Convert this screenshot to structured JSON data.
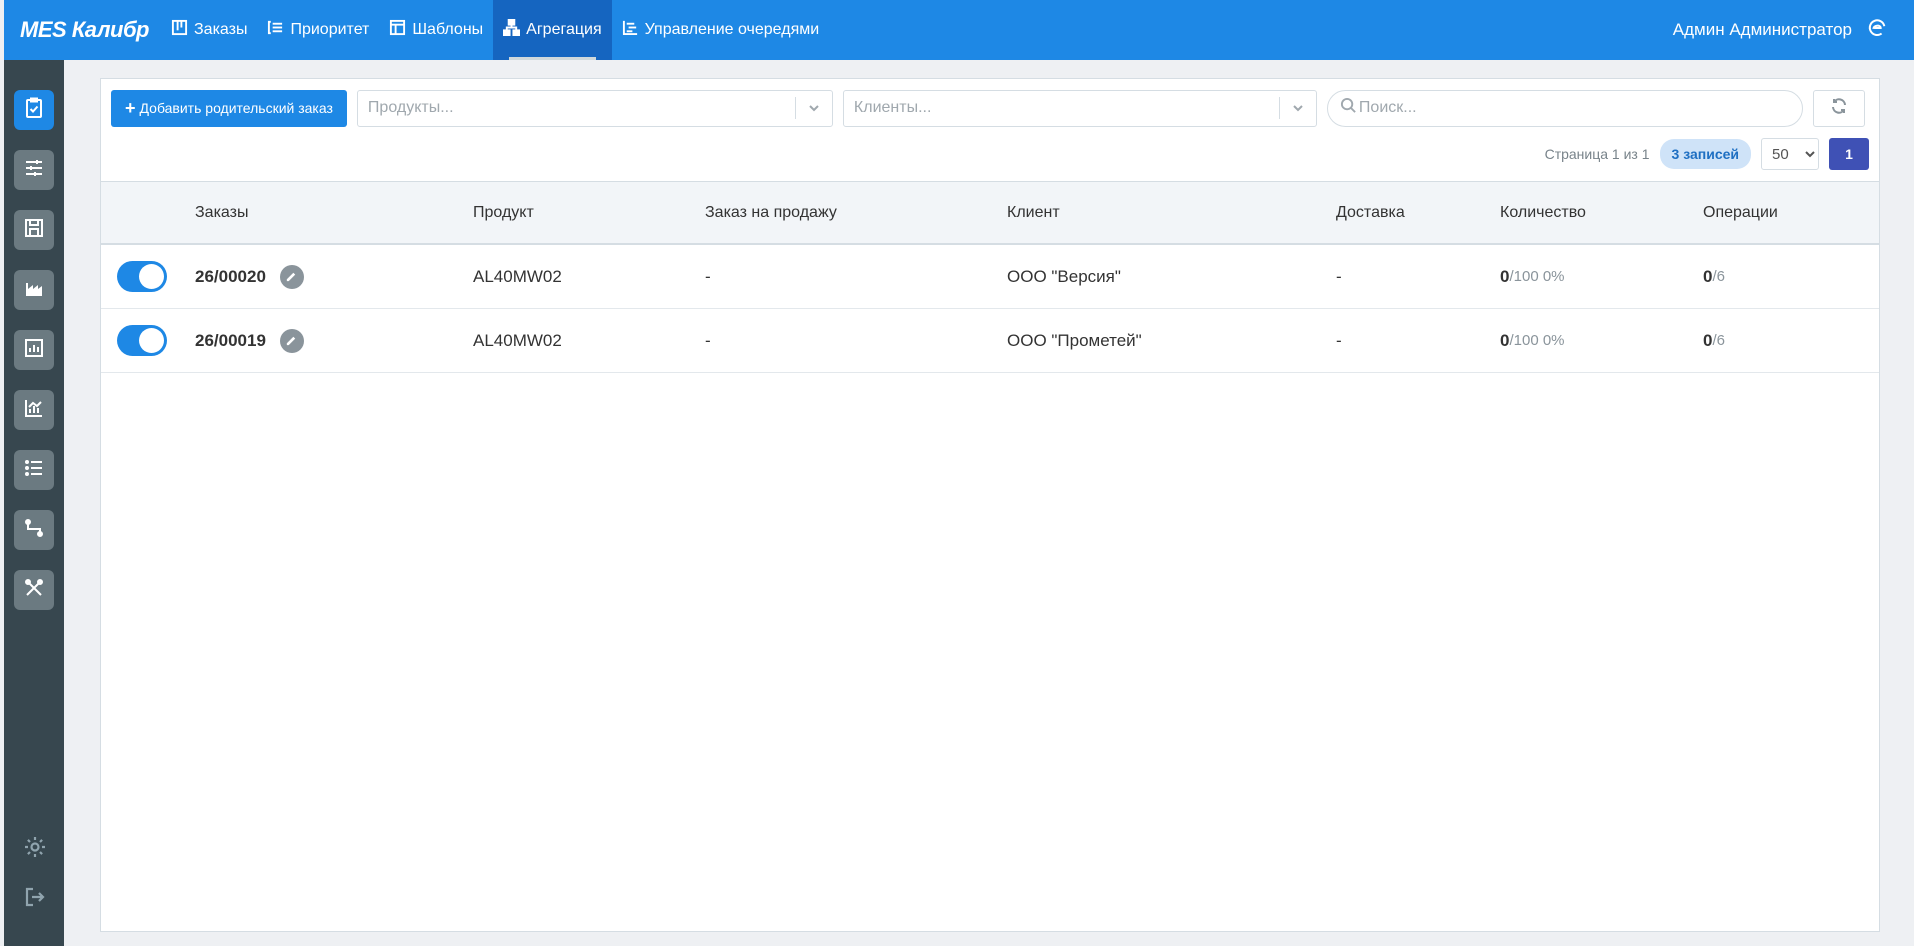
{
  "app": {
    "brand": "MES Калибр"
  },
  "nav": [
    {
      "label": "Заказы",
      "icon": "board-icon",
      "active": false
    },
    {
      "label": "Приоритет",
      "icon": "priority-icon",
      "active": false
    },
    {
      "label": "Шаблоны",
      "icon": "template-icon",
      "active": false
    },
    {
      "label": "Агрегация",
      "icon": "aggregation-icon",
      "active": true
    },
    {
      "label": "Управление очередями",
      "icon": "queue-icon",
      "active": false
    }
  ],
  "user": {
    "name": "Админ Администратор"
  },
  "sidebar": {
    "items": [
      "orders-icon",
      "sliders-icon",
      "save-icon",
      "factory-icon",
      "bar-chart-icon",
      "line-chart-icon",
      "list-icon",
      "route-icon",
      "tools-icon"
    ],
    "bottom": [
      "settings-icon",
      "logout-icon"
    ]
  },
  "toolbar": {
    "add_label": "Добавить родительский заказ",
    "products_placeholder": "Продукты...",
    "clients_placeholder": "Клиенты...",
    "search_placeholder": "Поиск..."
  },
  "pager": {
    "page_text": "Страница 1 из 1",
    "records_badge": "3 записей",
    "page_size": "50",
    "current_page": "1"
  },
  "table": {
    "columns": [
      "Заказы",
      "Продукт",
      "Заказ на продажу",
      "Клиент",
      "Доставка",
      "Количество",
      "Операции"
    ],
    "rows": [
      {
        "order": "26/00020",
        "product": "AL40MW02",
        "sales_order": "-",
        "client": "ООО \"Версия\"",
        "delivery": "-",
        "qty_done": "0",
        "qty_rest": "/100 0%",
        "ops_done": "0",
        "ops_rest": "/6"
      },
      {
        "order": "26/00019",
        "product": "AL40MW02",
        "sales_order": "-",
        "client": "ООО \"Прометей\"",
        "delivery": "-",
        "qty_done": "0",
        "qty_rest": "/100 0%",
        "ops_done": "0",
        "ops_rest": "/6"
      }
    ]
  }
}
